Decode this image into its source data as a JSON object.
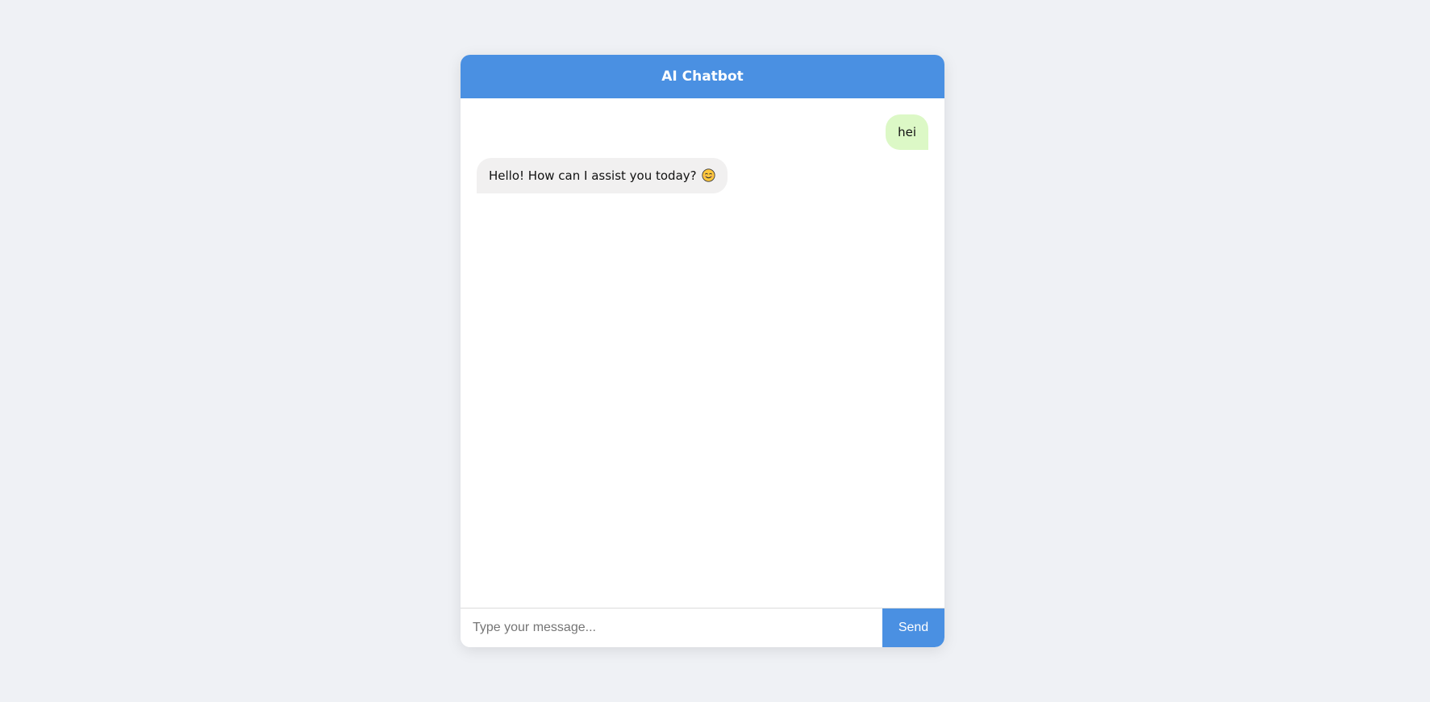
{
  "header": {
    "title": "AI Chatbot"
  },
  "messages": [
    {
      "sender": "user",
      "text": "hei"
    },
    {
      "sender": "bot",
      "text": "Hello! How can I assist you today?",
      "emoji": "smiling-face-emoji"
    }
  ],
  "input": {
    "placeholder": "Type your message...",
    "value": ""
  },
  "send": {
    "label": "Send"
  },
  "colors": {
    "accent": "#4a90e2",
    "user_bubble": "#dcf8c6",
    "bot_bubble": "#f1f0f0",
    "page_background": "#eff1f5"
  }
}
